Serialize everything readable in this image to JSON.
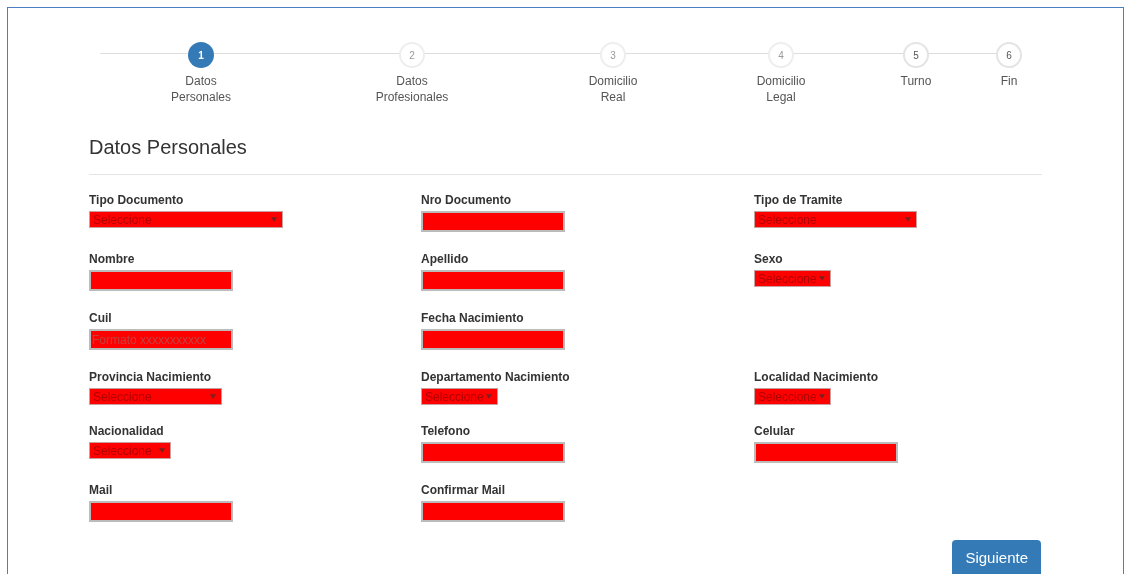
{
  "steps": [
    {
      "number": "1",
      "label": "Datos Personales",
      "selected": true,
      "disabled": false
    },
    {
      "number": "2",
      "label": "Datos Profesionales",
      "selected": false,
      "disabled": true
    },
    {
      "number": "3",
      "label": "Domicilio Real",
      "selected": false,
      "disabled": true
    },
    {
      "number": "4",
      "label": "Domicilio Legal",
      "selected": false,
      "disabled": true
    },
    {
      "number": "5",
      "label": "Turno",
      "selected": false,
      "disabled": false
    },
    {
      "number": "6",
      "label": "Fin",
      "selected": false,
      "disabled": false
    }
  ],
  "section_title": "Datos Personales",
  "form_rows": [
    {
      "fields": [
        {
          "label": "Tipo Documento",
          "kind": "select",
          "value": "Seleccione"
        },
        {
          "label": "Nro Documento",
          "kind": "input"
        },
        {
          "label": "Tipo de Tramite",
          "kind": "select",
          "value": "Seleccione"
        }
      ]
    },
    {
      "fields": [
        {
          "label": "Nombre",
          "kind": "input"
        },
        {
          "label": "Apellido",
          "kind": "input"
        },
        {
          "label": "Sexo",
          "kind": "select",
          "value": "Seleccione"
        }
      ]
    },
    {
      "fields": [
        {
          "label": "Cuil",
          "kind": "input",
          "placeholder": "Formato xxxxxxxxxxx"
        },
        {
          "label": "Fecha Nacimiento",
          "kind": "input"
        }
      ]
    },
    {
      "fields": [
        {
          "label": "Provincia Nacimiento",
          "kind": "select",
          "value": "Seleccione"
        },
        {
          "label": "Departamento Nacimiento",
          "kind": "select",
          "value": "Seleccione"
        },
        {
          "label": "Localidad Nacimiento",
          "kind": "select",
          "value": "Seleccione"
        }
      ]
    },
    {
      "fields": [
        {
          "label": "Nacionalidad",
          "kind": "select",
          "value": "Seleccione"
        },
        {
          "label": "Telefono",
          "kind": "input"
        },
        {
          "label": "Celular",
          "kind": "input"
        }
      ]
    },
    {
      "fields": [
        {
          "label": "Mail",
          "kind": "input"
        },
        {
          "label": "Confirmar Mail",
          "kind": "input"
        }
      ]
    }
  ],
  "next_button": "Siguiente"
}
